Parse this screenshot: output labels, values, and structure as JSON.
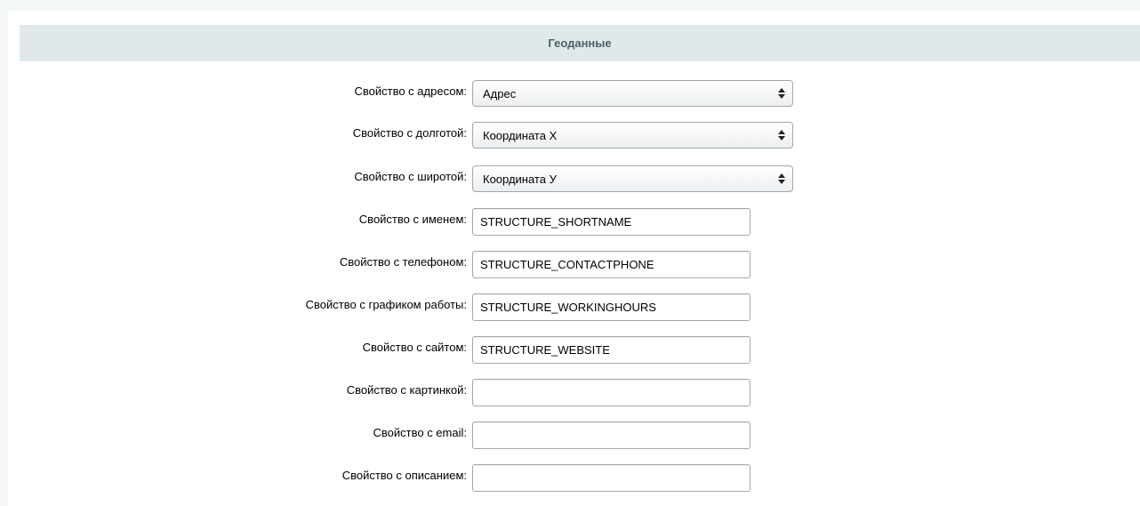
{
  "section": {
    "title": "Геоданные"
  },
  "selects": [
    {
      "label": "Свойство с адресом:",
      "value": "Адрес"
    },
    {
      "label": "Свойство с долготой:",
      "value": "Координата X"
    },
    {
      "label": "Свойство с широтой:",
      "value": "Координата У"
    }
  ],
  "inputs": [
    {
      "label": "Свойство с именем:",
      "value": "STRUCTURE_SHORTNAME"
    },
    {
      "label": "Свойство с телефоном:",
      "value": "STRUCTURE_CONTACTPHONE"
    },
    {
      "label": "Свойство с графиком работы:",
      "value": "STRUCTURE_WORKINGHOURS"
    },
    {
      "label": "Свойство с сайтом:",
      "value": "STRUCTURE_WEBSITE"
    },
    {
      "label": "Свойство с картинкой:",
      "value": ""
    },
    {
      "label": "Свойство с email:",
      "value": ""
    },
    {
      "label": "Свойство с описанием:",
      "value": ""
    }
  ],
  "icons": {
    "select_arrow": "select-arrows-icon"
  }
}
